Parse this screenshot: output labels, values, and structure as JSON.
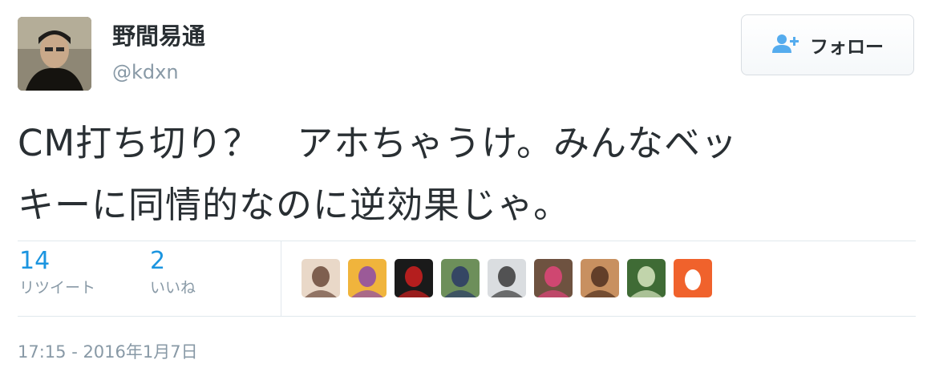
{
  "author": {
    "name": "野間易通",
    "handle": "@kdxn"
  },
  "follow_button": {
    "label": "フォロー",
    "icon": "add-user-icon"
  },
  "tweet": {
    "text_lines": [
      "CM打ち切り？　アホちゃうけ。みんなベッ",
      "キーに同情的なのに逆効果じゃ。"
    ]
  },
  "stats": {
    "retweets": {
      "count": "14",
      "label": "リツイート"
    },
    "likes": {
      "count": "2",
      "label": "いいね"
    }
  },
  "likers": [
    {
      "name": "liker-avatar-1",
      "colors": [
        "#e9d8c8",
        "#6b4a3a"
      ]
    },
    {
      "name": "liker-avatar-2",
      "colors": [
        "#f0b43c",
        "#8c4aa8"
      ]
    },
    {
      "name": "liker-avatar-3",
      "colors": [
        "#1a1a1a",
        "#d02020"
      ]
    },
    {
      "name": "liker-avatar-4",
      "colors": [
        "#6d8f5a",
        "#2b3a66"
      ]
    },
    {
      "name": "liker-avatar-5",
      "colors": [
        "#dadde0",
        "#3a3a3a"
      ]
    },
    {
      "name": "liker-avatar-6",
      "colors": [
        "#6e5240",
        "#e0457a"
      ]
    },
    {
      "name": "liker-avatar-7",
      "colors": [
        "#c89060",
        "#503020"
      ]
    },
    {
      "name": "liker-avatar-8",
      "colors": [
        "#3f6b35",
        "#d8e6c0"
      ]
    },
    {
      "name": "liker-avatar-9",
      "colors": [
        "#f0622c",
        "#ffffff"
      ]
    }
  ],
  "timestamp": "17:15 - 2016年1月7日",
  "colors": {
    "link_blue": "#1b95e0",
    "muted_gray": "#8899a6",
    "text_dark": "#292f33"
  }
}
